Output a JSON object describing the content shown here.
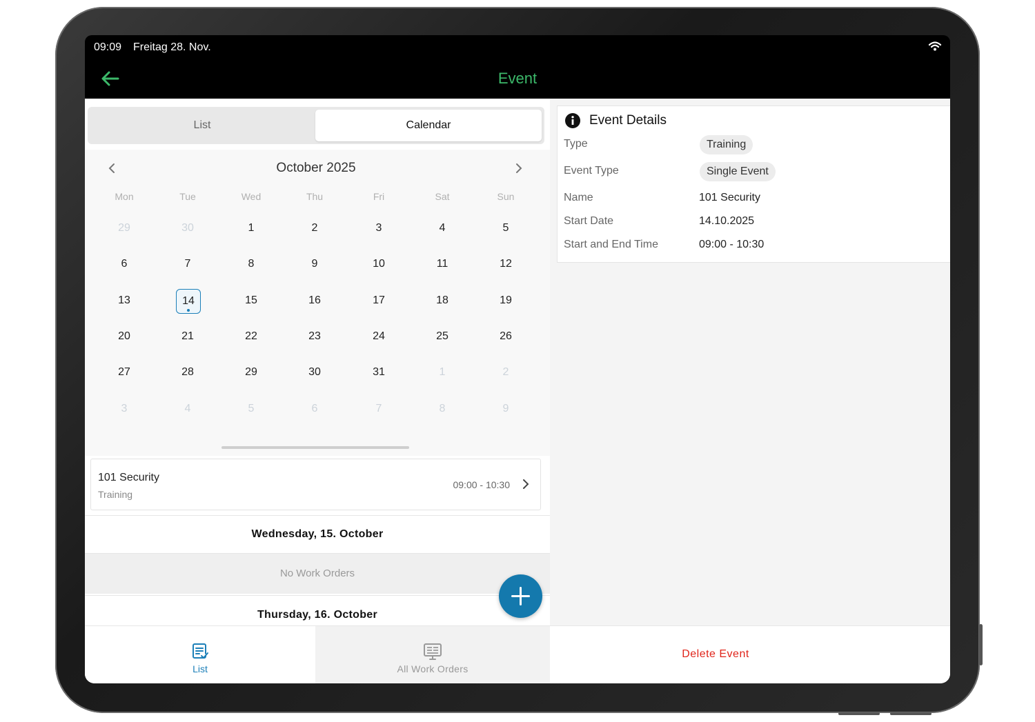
{
  "status_bar": {
    "time": "09:09",
    "date": "Freitag 28. Nov."
  },
  "navbar": {
    "title": "Event"
  },
  "segment": {
    "list_label": "List",
    "calendar_label": "Calendar"
  },
  "calendar": {
    "month_title": "October 2025",
    "weekdays": [
      "Mon",
      "Tue",
      "Wed",
      "Thu",
      "Fri",
      "Sat",
      "Sun"
    ],
    "weeks": [
      [
        "29",
        "30",
        "1",
        "2",
        "3",
        "4",
        "5"
      ],
      [
        "6",
        "7",
        "8",
        "9",
        "10",
        "11",
        "12"
      ],
      [
        "13",
        "14",
        "15",
        "16",
        "17",
        "18",
        "19"
      ],
      [
        "20",
        "21",
        "22",
        "23",
        "24",
        "25",
        "26"
      ],
      [
        "27",
        "28",
        "29",
        "30",
        "31",
        "1",
        "2"
      ],
      [
        "3",
        "4",
        "5",
        "6",
        "7",
        "8",
        "9"
      ]
    ],
    "muted": [
      [
        0,
        0
      ],
      [
        0,
        1
      ],
      [
        4,
        5
      ],
      [
        4,
        6
      ],
      [
        5,
        0
      ],
      [
        5,
        1
      ],
      [
        5,
        2
      ],
      [
        5,
        3
      ],
      [
        5,
        4
      ],
      [
        5,
        5
      ],
      [
        5,
        6
      ]
    ],
    "selected": [
      2,
      1
    ]
  },
  "event_card": {
    "name": "101 Security",
    "type": "Training",
    "time": "09:00 - 10:30"
  },
  "day_sections": [
    {
      "heading": "Wednesday, 15. October",
      "empty_text": "No Work Orders"
    },
    {
      "heading": "Thursday, 16. October"
    }
  ],
  "tabbar": {
    "list_label": "List",
    "all_label": "All Work Orders"
  },
  "details": {
    "title": "Event Details",
    "rows": [
      {
        "label": "Type",
        "value": "Training",
        "chip": true
      },
      {
        "label": "Event Type",
        "value": "Single Event",
        "chip": true
      },
      {
        "label": "Name",
        "value": "101 Security",
        "chip": false
      },
      {
        "label": "Start Date",
        "value": "14.10.2025",
        "chip": false
      },
      {
        "label": "Start and End Time",
        "value": "09:00 - 10:30",
        "chip": false
      }
    ]
  },
  "actions": {
    "delete_label": "Delete Event"
  },
  "colors": {
    "accent_green": "#3cb96a",
    "primary_blue": "#1479ad",
    "danger_red": "#e0241a"
  }
}
